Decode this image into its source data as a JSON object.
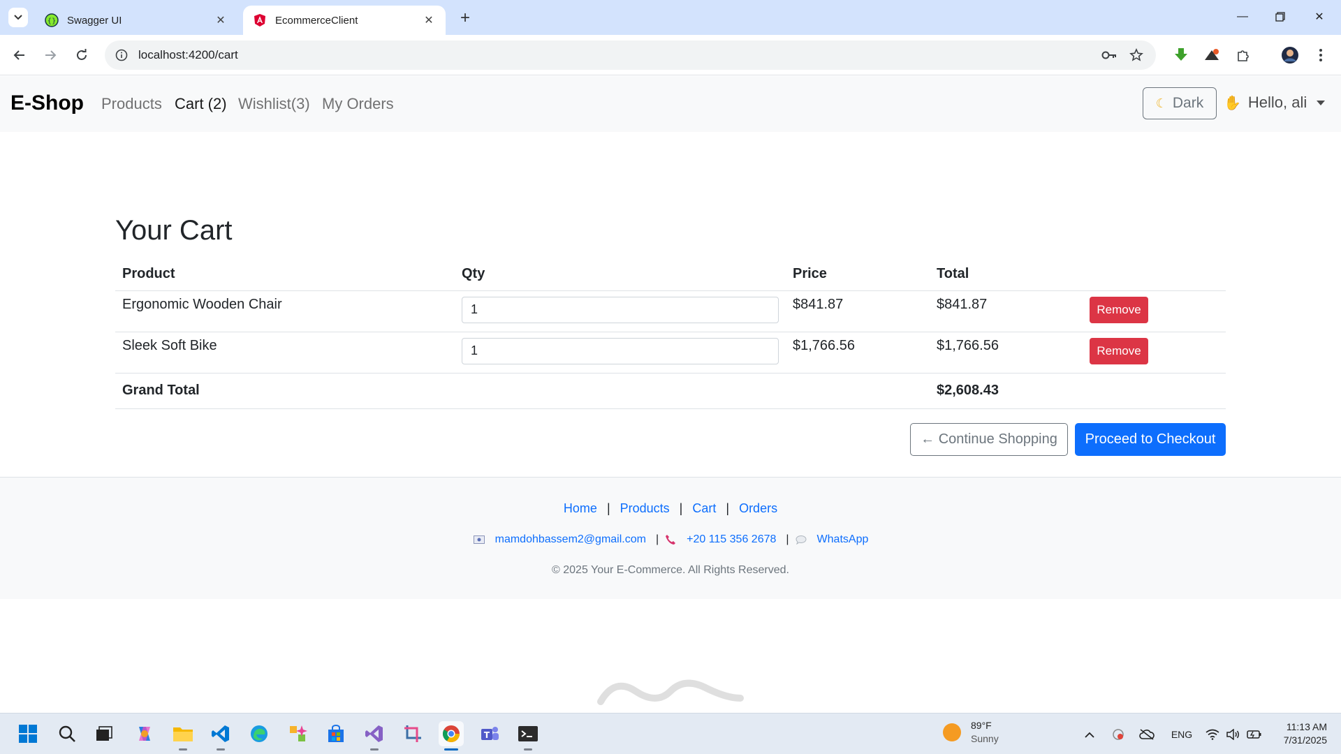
{
  "browser": {
    "tabs": [
      {
        "title": "Swagger UI",
        "active": false
      },
      {
        "title": "EcommerceClient",
        "active": true
      }
    ],
    "url": "localhost:4200/cart"
  },
  "navbar": {
    "brand": "E-Shop",
    "links": [
      "Products",
      "Cart (2)",
      "Wishlist(3)",
      "My Orders"
    ],
    "theme_button": "Dark",
    "user_greeting": "Hello, ali"
  },
  "cart": {
    "title": "Your Cart",
    "columns": [
      "Product",
      "Qty",
      "Price",
      "Total"
    ],
    "items": [
      {
        "product": "Ergonomic Wooden Chair",
        "qty": "1",
        "price": "$841.87",
        "total": "$841.87",
        "action": "Remove"
      },
      {
        "product": "Sleek Soft Bike",
        "qty": "1",
        "price": "$1,766.56",
        "total": "$1,766.56",
        "action": "Remove"
      }
    ],
    "grand_total_label": "Grand Total",
    "grand_total": "$2,608.43",
    "continue_label": "← Continue Shopping",
    "checkout_label": "Proceed to Checkout"
  },
  "footer": {
    "links": [
      "Home",
      "Products",
      "Cart",
      "Orders"
    ],
    "separator": "|",
    "email": "mamdohbassem2@gmail.com",
    "phone": "+20 115 356 2678",
    "whatsapp": "WhatsApp",
    "copyright": "© 2025 Your E-Commerce. All Rights Reserved."
  },
  "taskbar": {
    "weather_temp": "89°F",
    "weather_desc": "Sunny",
    "language": "ENG",
    "time": "11:13 AM",
    "date": "7/31/2025"
  },
  "colors": {
    "primary": "#0d6efd",
    "danger": "#dc3545",
    "secondary": "#6c757d",
    "tabbar": "#d3e3fd"
  }
}
